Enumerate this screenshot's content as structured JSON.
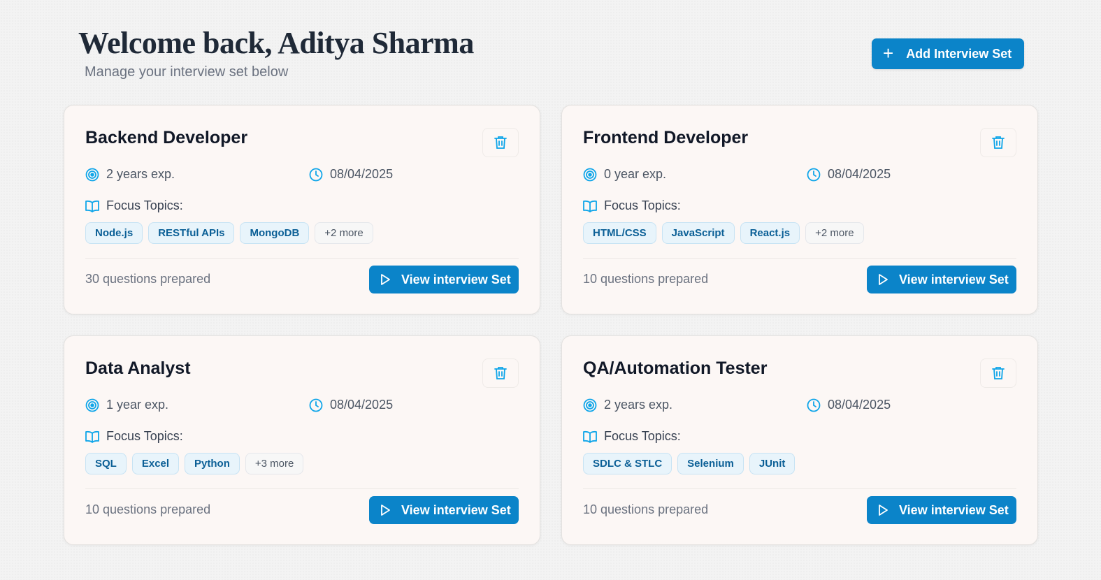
{
  "header": {
    "title": "Welcome back, Aditya Sharma",
    "subtitle": "Manage your interview set below",
    "add_button_label": "Add Interview Set"
  },
  "colors": {
    "accent": "#0b84c9",
    "icon": "#0ea5e9",
    "card_bg": "#fcf7f5"
  },
  "cards": [
    {
      "title": "Backend Developer",
      "experience": "2 years exp.",
      "date": "08/04/2025",
      "focus_label": "Focus Topics:",
      "tags": [
        "Node.js",
        "RESTful APIs",
        "MongoDB"
      ],
      "more": "+2 more",
      "questions": "30 questions prepared",
      "view_label": "View interview Set"
    },
    {
      "title": "Frontend Developer",
      "experience": "0 year exp.",
      "date": "08/04/2025",
      "focus_label": "Focus Topics:",
      "tags": [
        "HTML/CSS",
        "JavaScript",
        "React.js"
      ],
      "more": "+2 more",
      "questions": "10 questions prepared",
      "view_label": "View interview Set"
    },
    {
      "title": "Data Analyst",
      "experience": "1 year exp.",
      "date": "08/04/2025",
      "focus_label": "Focus Topics:",
      "tags": [
        "SQL",
        "Excel",
        "Python"
      ],
      "more": "+3 more",
      "questions": "10 questions prepared",
      "view_label": "View interview Set"
    },
    {
      "title": "QA/Automation Tester",
      "experience": "2 years exp.",
      "date": "08/04/2025",
      "focus_label": "Focus Topics:",
      "tags": [
        "SDLC & STLC",
        "Selenium",
        "JUnit"
      ],
      "more": "",
      "questions": "10 questions prepared",
      "view_label": "View interview Set"
    }
  ]
}
